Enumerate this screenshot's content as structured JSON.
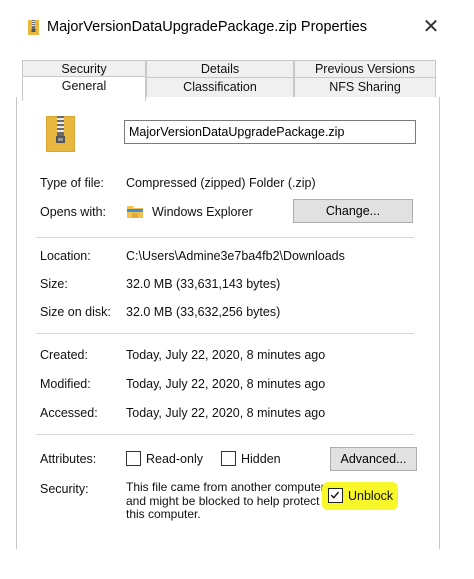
{
  "window": {
    "title": "MajorVersionDataUpgradePackage.zip Properties",
    "close_symbol": "✕"
  },
  "tabs": {
    "back_row": [
      "Security",
      "Details",
      "Previous Versions"
    ],
    "front_row": [
      "General",
      "Classification",
      "NFS Sharing"
    ],
    "active": "General"
  },
  "general": {
    "file_name": "MajorVersionDataUpgradePackage.zip",
    "type_of_file": {
      "label": "Type of file:",
      "value": "Compressed (zipped) Folder (.zip)"
    },
    "opens_with": {
      "label": "Opens with:",
      "value": "Windows Explorer",
      "change_button": "Change..."
    },
    "location": {
      "label": "Location:",
      "value": "C:\\Users\\Admine3e7ba4fb2\\Downloads"
    },
    "size": {
      "label": "Size:",
      "value": "32.0 MB (33,631,143 bytes)"
    },
    "size_on_disk": {
      "label": "Size on disk:",
      "value": "32.0 MB (33,632,256 bytes)"
    },
    "created": {
      "label": "Created:",
      "value": "Today, July 22, 2020, 8 minutes ago"
    },
    "modified": {
      "label": "Modified:",
      "value": "Today, July 22, 2020, 8 minutes ago"
    },
    "accessed": {
      "label": "Accessed:",
      "value": "Today, July 22, 2020, 8 minutes ago"
    },
    "attributes": {
      "label": "Attributes:",
      "read_only": "Read-only",
      "hidden": "Hidden",
      "advanced_button": "Advanced..."
    },
    "security": {
      "label": "Security:",
      "text": "This file came from another computer and might be blocked to help protect this computer.",
      "unblock": "Unblock",
      "unblock_checked": true
    }
  },
  "colors": {
    "highlight": "#f7f72a",
    "folder_yellow": "#e8b73d",
    "zip_stripe": "#6b6b6b"
  },
  "icons": {
    "title_icon": "zip-folder-icon",
    "file_icon": "zip-folder-icon",
    "opens_with_icon": "windows-explorer-folder-icon",
    "close_icon": "close-icon"
  }
}
